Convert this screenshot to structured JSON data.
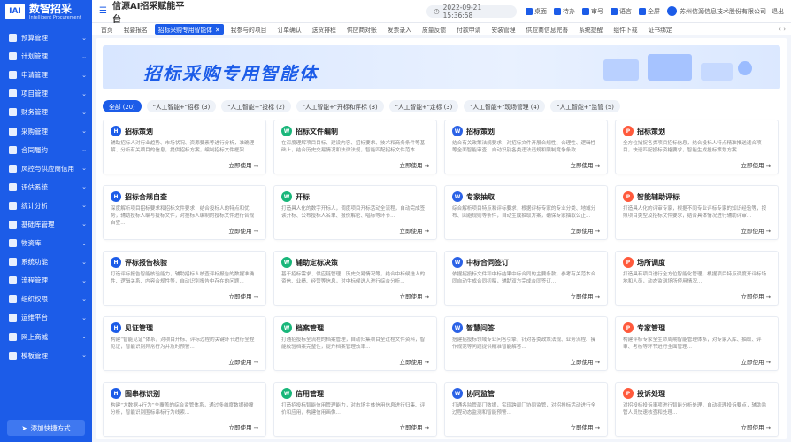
{
  "sidebar": {
    "logo_mark": "IAI",
    "logo_title": "数智招采",
    "logo_sub": "Intelligent Procurement",
    "items": [
      {
        "label": "预算管理",
        "icon": "budget-icon"
      },
      {
        "label": "计划管理",
        "icon": "plan-icon"
      },
      {
        "label": "申请管理",
        "icon": "apply-icon"
      },
      {
        "label": "项目管理",
        "icon": "project-icon"
      },
      {
        "label": "财务管理",
        "icon": "finance-icon"
      },
      {
        "label": "采购管理",
        "icon": "purchase-icon"
      },
      {
        "label": "合同履约",
        "icon": "contract-icon"
      },
      {
        "label": "风控与供应商信用",
        "icon": "shield-icon"
      },
      {
        "label": "评估系统",
        "icon": "evaluate-icon"
      },
      {
        "label": "统计分析",
        "icon": "stats-icon"
      },
      {
        "label": "基础库管理",
        "icon": "database-icon"
      },
      {
        "label": "物资库",
        "icon": "material-icon"
      },
      {
        "label": "系统功能",
        "icon": "system-icon"
      },
      {
        "label": "流程管理",
        "icon": "flow-icon"
      },
      {
        "label": "组织权限",
        "icon": "org-icon"
      },
      {
        "label": "运维平台",
        "icon": "ops-icon"
      },
      {
        "label": "网上商城",
        "icon": "mall-icon"
      },
      {
        "label": "模板管理",
        "icon": "template-icon"
      }
    ],
    "add_shortcut": "添加快捷方式"
  },
  "header": {
    "toggle": "☰",
    "title": "信源AI招采赋能平台",
    "datetime": "2022-09-21 15:36:58",
    "actions": [
      "桌面",
      "待办",
      "审号",
      "语言",
      "全屏"
    ],
    "company": "苏州信源信息技术股份有限公司",
    "logout": "退出"
  },
  "tabs": {
    "items": [
      "首页",
      "我要报名",
      "招标采购专用智能体",
      "我参与的项目",
      "订单确认",
      "送货排程",
      "供应商对账",
      "发票录入",
      "质量反馈",
      "付款申请",
      "安装管理",
      "供应商信息完善",
      "系统提醒",
      "组件下载",
      "证书绑定"
    ],
    "active_index": 2,
    "controls": "‹ ›"
  },
  "banner": {
    "title": "招标采购专用智能体"
  },
  "filters": [
    "全部 (20)",
    "\"人工智能+\"招标 (3)",
    "\"人工智能+\"投标 (2)",
    "\"人工智能+\"开标和评标 (3)",
    "\"人工智能+\"定标 (3)",
    "\"人工智能+\"现场管理 (4)",
    "\"人工智能+\"监管 (5)"
  ],
  "active_filter": 0,
  "use_label": "立即使用 →",
  "cards": [
    {
      "title": "招标策划",
      "icon": "h",
      "color": "#1c5ce8",
      "desc": "辅助招标人对行业趋势、市场状况、资源要素等进行分析，准确理解、分析有关项目的信息，提供招标方案，编制招标文件框架..."
    },
    {
      "title": "招标文件编制",
      "icon": "w",
      "color": "#19b67a",
      "desc": "在深度理解项目目标、建设内容、招标要求、技术和商务条件等基础上，结合历史交易情况和法律法规，智能匹配招标文件范本..."
    },
    {
      "title": "招标策划",
      "icon": "w",
      "color": "#2b62e6",
      "desc": "结合有关政策法规要求，对招标文件开展合规性、合理性、逻辑性等全面智能审查，自动识别各类违法违规和限制竞争条款..."
    },
    {
      "title": "招标策划",
      "icon": "p",
      "color": "#ff5a3c",
      "desc": "全方位捕捉各类项目招标信息，结合投标人特点精准推送适合项目，快速匹配投标资格要求，智能生成投标策划方案..."
    },
    {
      "title": "招标合规自查",
      "icon": "h",
      "color": "#1c5ce8",
      "desc": "深度解析项目招标要求和招标文件要求，结合投标人的特点和优势，辅助投标人编写投标文件，对投标人编制的投标文件进行合规自查..."
    },
    {
      "title": "开标",
      "icon": "w",
      "color": "#19b67a",
      "desc": "打造具人化的数字开标人，调度项目开标活动全流程，自动完成签读开标、公布投标人名单、报价解密、唱标等环节..."
    },
    {
      "title": "专家抽取",
      "icon": "w",
      "color": "#2b62e6",
      "desc": "综合解析项目特点和评标要求，根据评标专家的专业分类、地域分布、回避规则等条件，自动生成抽取方案，确保专家抽取公正..."
    },
    {
      "title": "智能辅助评标",
      "icon": "p",
      "color": "#ff5a3c",
      "desc": "打造具人化的评审专家，根据不同专业评标专家的知识经验等，按照项目类型及招标文件要求，结合具体情况进行辅助评审..."
    },
    {
      "title": "评标报告核验",
      "icon": "h",
      "color": "#1c5ce8",
      "desc": "打造评标报告智能核验能力，辅助招标人核查评标报告的数据准确性、逻辑关系、内容合规性等，自动识别报告中存在的问题..."
    },
    {
      "title": "辅助定标决策",
      "icon": "w",
      "color": "#19b67a",
      "desc": "基于招标需求、供应链管理、历史交易情况等，结合中标候选人的资信、业绩、经营等信息，对中标候选人进行综合分析..."
    },
    {
      "title": "中标合同签订",
      "icon": "w",
      "color": "#2b62e6",
      "desc": "依据招投标文件和中标结果中标合同的主要条款，参考有关范本合同自动生成合同初稿，辅助双方完成合同签订..."
    },
    {
      "title": "场所调度",
      "icon": "p",
      "color": "#ff5a3c",
      "desc": "打造具有项目进行全方位智能化管理，根据项目特点调度开评标场地和人员，动态监测场所使用情况..."
    },
    {
      "title": "见证管理",
      "icon": "h",
      "color": "#1c5ce8",
      "desc": "构建“智能见证”体系，对项目开标、评标过程的关键环节进行全程见证，智能识别异常行为并及时预警..."
    },
    {
      "title": "档案管理",
      "icon": "w",
      "color": "#19b67a",
      "desc": "打通招投标全流程的档案管理，自动归集项目全过程文件资料，智能校验档案完整性，提升档案管理效率..."
    },
    {
      "title": "智慧问答",
      "icon": "w",
      "color": "#2b62e6",
      "desc": "搭建招投标领域专业问答引擎，针对各类政策法规、业务流程、操作规范等问题提供精准智能解答..."
    },
    {
      "title": "专家管理",
      "icon": "p",
      "color": "#ff5a3c",
      "desc": "构建评标专家全生命周期智能管理体系，对专家入库、抽取、评审、考核等环节进行全面管理..."
    },
    {
      "title": "围串标识别",
      "icon": "h",
      "color": "#1c5ce8",
      "desc": "构建“大数据+行为”全覆盖的综合监管体系，通过多维度数据碰撞分析，智能识别围标串标行为线索..."
    },
    {
      "title": "信用管理",
      "icon": "w",
      "color": "#19b67a",
      "desc": "打造招投标智能信用管理能力，对市场主体信用信息进行归集、评价和应用，构建信用画像..."
    },
    {
      "title": "协同监管",
      "icon": "w",
      "color": "#2b62e6",
      "desc": "打通各监管部门数据，实现跨部门协同监管，对招投标活动进行全过程动态监测和智能预警..."
    },
    {
      "title": "投诉处理",
      "icon": "p",
      "color": "#ff5a3c",
      "desc": "对招投标投诉事项进行智能分析处理，自动梳理投诉要点，辅助监管人员快速核查和处理..."
    }
  ]
}
